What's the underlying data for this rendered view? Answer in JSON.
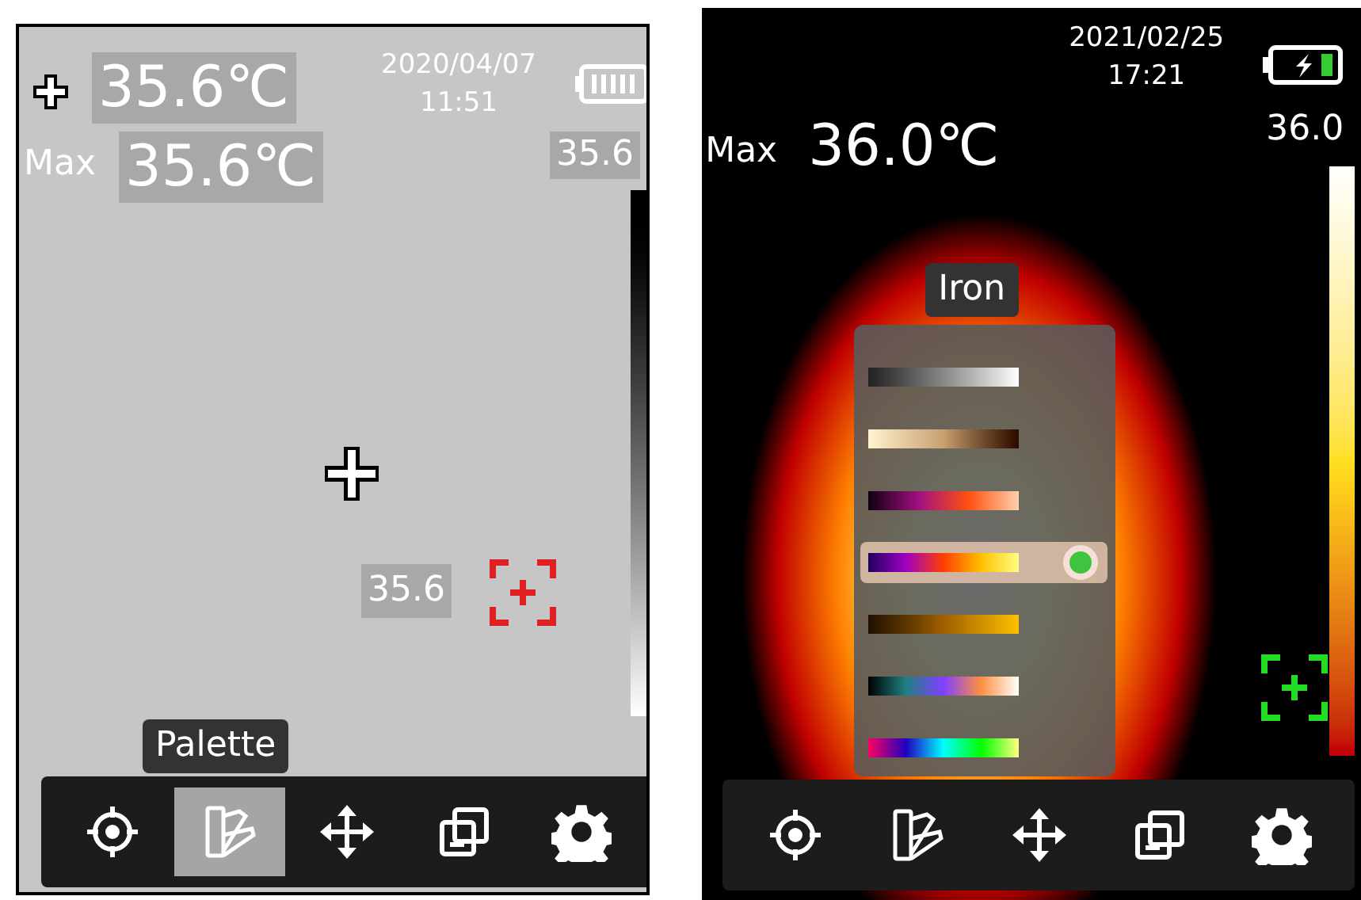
{
  "screens": [
    {
      "kind": "grayscale",
      "battery": {
        "kind": "full"
      },
      "crosshair_reading": "35.6℃",
      "max_label": "Max",
      "max_reading": "35.6℃",
      "date": "2020/04/07",
      "time": "11:51",
      "scale_max": "35.6",
      "spot_reading": "35.6",
      "spot_marker": {
        "color": "#e02020"
      },
      "tooltip": "Palette",
      "toolbar": [
        {
          "kind": "target",
          "selected": false
        },
        {
          "kind": "palette",
          "selected": true
        },
        {
          "kind": "move",
          "selected": false
        },
        {
          "kind": "layers",
          "selected": false
        },
        {
          "kind": "settings",
          "selected": false
        }
      ]
    },
    {
      "kind": "iron",
      "battery": {
        "kind": "charging"
      },
      "max_label": "Max",
      "max_reading": "36.0℃",
      "date": "2021/02/25",
      "time": "17:21",
      "scale_max": "36.0",
      "spot_marker": {
        "color": "#22dd22"
      },
      "tooltip": "Iron",
      "palette_menu": [
        {
          "kind": "whitehot",
          "selected": false
        },
        {
          "kind": "sepia",
          "selected": false
        },
        {
          "kind": "magma",
          "selected": false
        },
        {
          "kind": "iron",
          "selected": true
        },
        {
          "kind": "amber",
          "selected": false
        },
        {
          "kind": "spectrum",
          "selected": false
        },
        {
          "kind": "rainbow",
          "selected": false
        }
      ],
      "toolbar": [
        {
          "kind": "target",
          "selected": false
        },
        {
          "kind": "palette",
          "selected": false
        },
        {
          "kind": "move",
          "selected": false
        },
        {
          "kind": "layers",
          "selected": false
        },
        {
          "kind": "settings",
          "selected": false
        }
      ]
    }
  ]
}
